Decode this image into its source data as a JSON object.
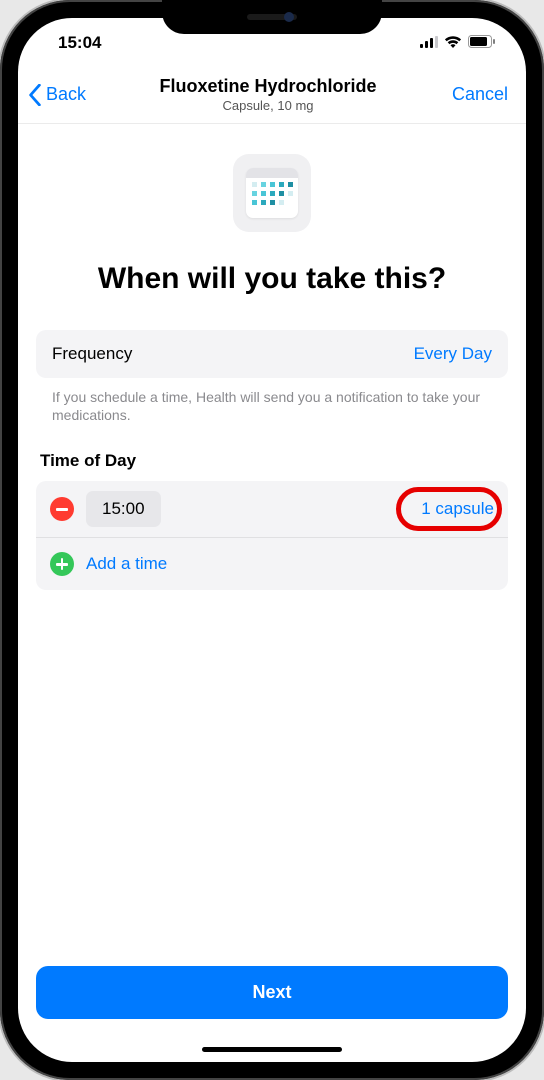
{
  "status": {
    "time": "15:04"
  },
  "nav": {
    "back": "Back",
    "title": "Fluoxetine Hydrochloride",
    "subtitle": "Capsule, 10 mg",
    "cancel": "Cancel"
  },
  "heading": "When will you take this?",
  "frequency": {
    "label": "Frequency",
    "value": "Every Day"
  },
  "hint": "If you schedule a time, Health will send you a notification to take your medications.",
  "timeOfDay": {
    "header": "Time of Day",
    "entries": [
      {
        "time": "15:00",
        "dose": "1 capsule"
      }
    ],
    "add": "Add a time"
  },
  "next": "Next"
}
